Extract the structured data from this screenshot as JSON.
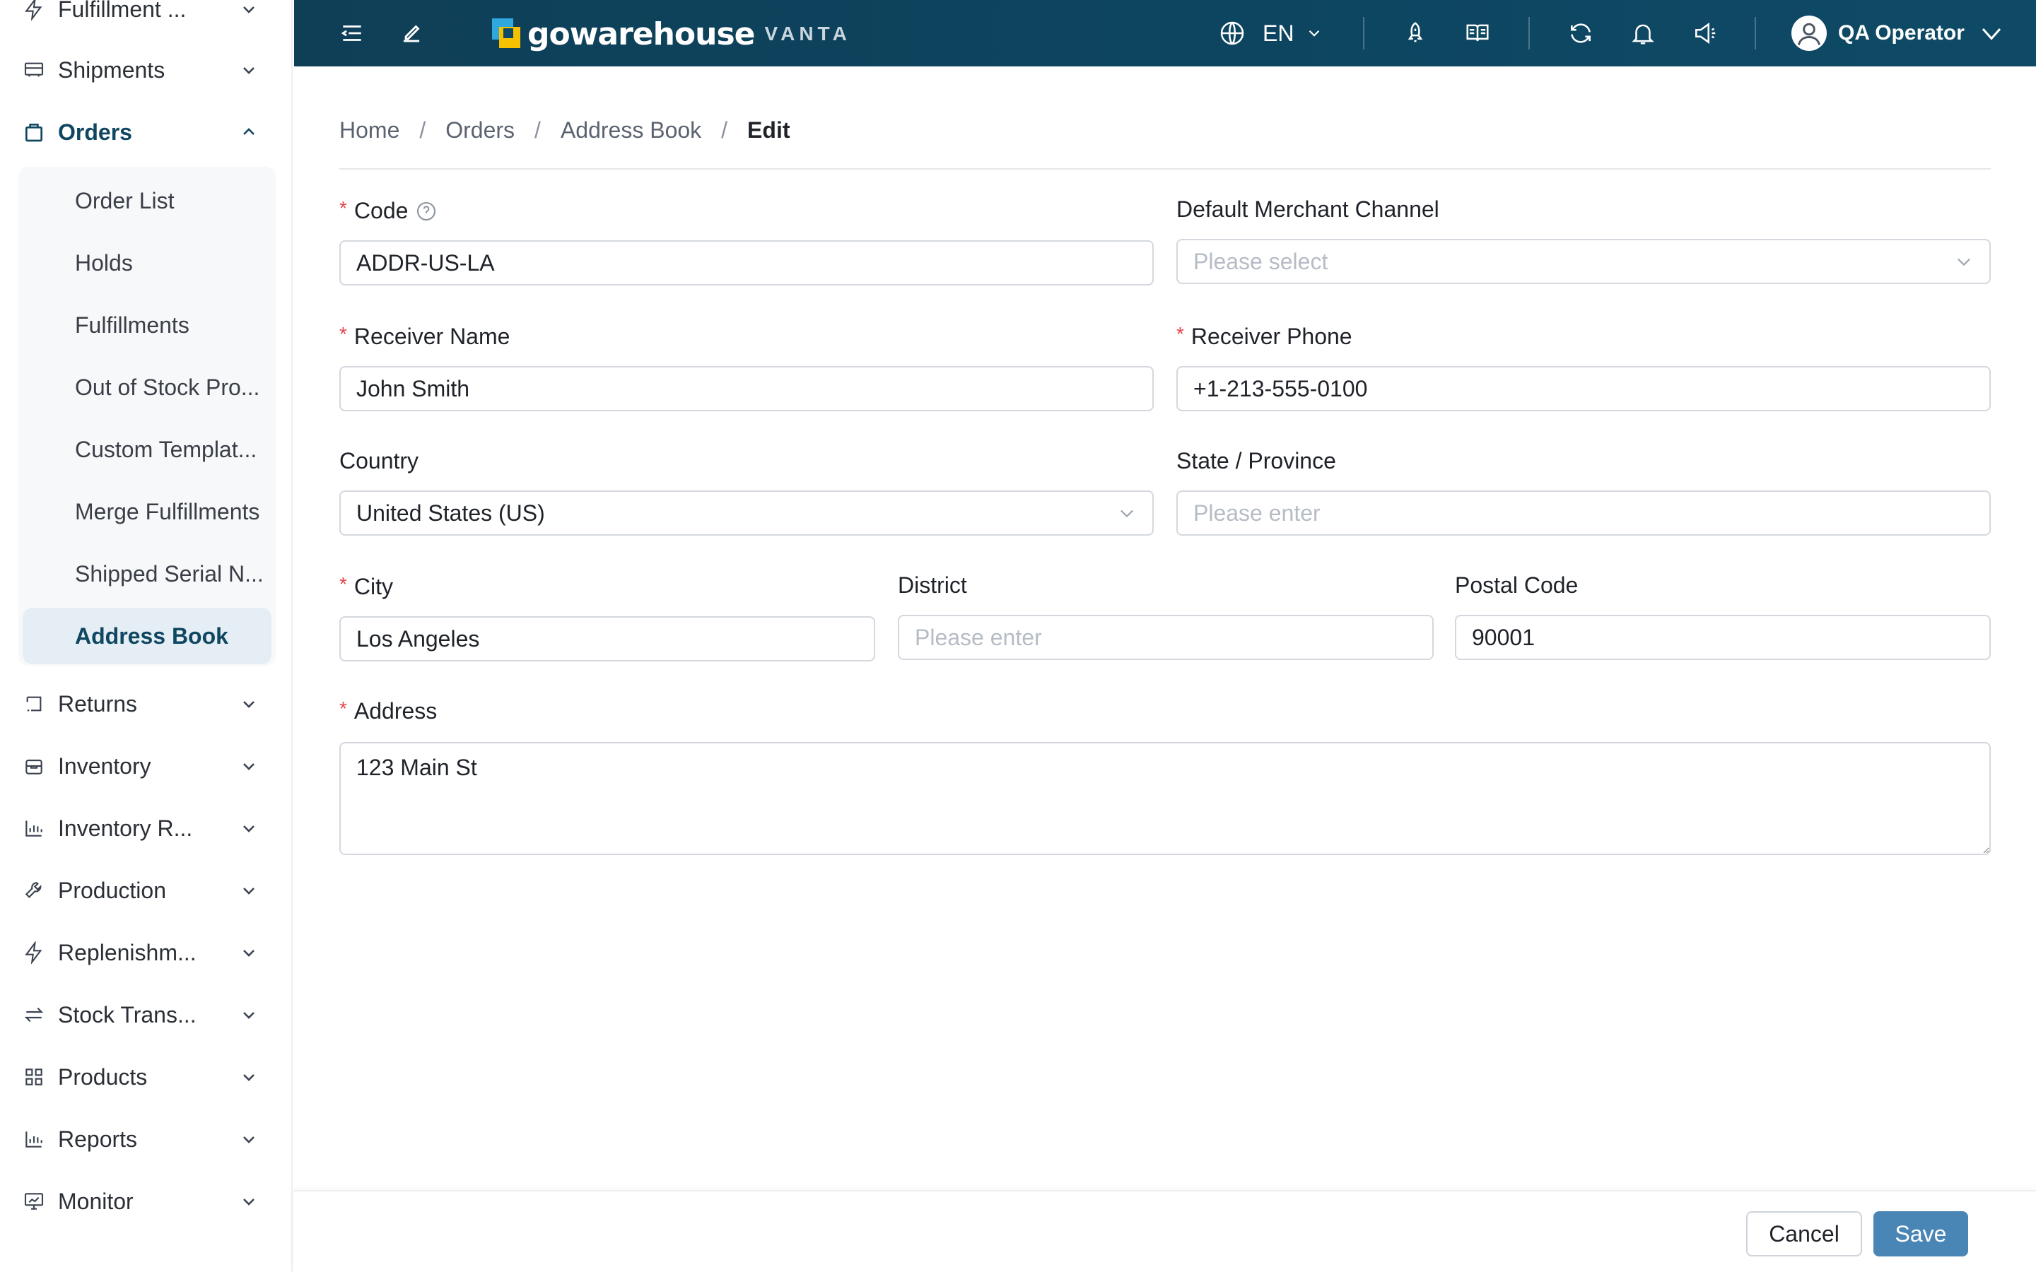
{
  "app": {
    "logo_text": "gowarehouse",
    "logo_sub": "VANTA",
    "language": "EN",
    "user_name": "QA Operator"
  },
  "sidebar": {
    "top_items": [
      {
        "label": "Fulfillment ...",
        "icon": "bolt-icon"
      },
      {
        "label": "Shipments",
        "icon": "truck-icon"
      },
      {
        "label": "Orders",
        "icon": "shopping-bag-icon"
      }
    ],
    "orders_submenu": [
      {
        "label": "Order List"
      },
      {
        "label": "Holds"
      },
      {
        "label": "Fulfillments"
      },
      {
        "label": "Out of Stock Pro..."
      },
      {
        "label": "Custom Templat..."
      },
      {
        "label": "Merge Fulfillments"
      },
      {
        "label": "Shipped Serial N..."
      },
      {
        "label": "Address Book"
      }
    ],
    "bottom_items": [
      {
        "label": "Returns",
        "icon": "return-icon"
      },
      {
        "label": "Inventory",
        "icon": "box-icon"
      },
      {
        "label": "Inventory R...",
        "icon": "bar-chart-icon"
      },
      {
        "label": "Production",
        "icon": "wrench-icon"
      },
      {
        "label": "Replenishm...",
        "icon": "bolt-icon"
      },
      {
        "label": "Stock Trans...",
        "icon": "transfer-icon"
      },
      {
        "label": "Products",
        "icon": "grid-icon"
      },
      {
        "label": "Reports",
        "icon": "bar-chart-icon"
      },
      {
        "label": "Monitor",
        "icon": "monitor-icon"
      }
    ]
  },
  "breadcrumb": {
    "items": [
      "Home",
      "Orders",
      "Address Book"
    ],
    "current": "Edit",
    "separator": "/"
  },
  "form": {
    "code": {
      "label": "Code",
      "value": "ADDR-US-LA"
    },
    "merchant_channel": {
      "label": "Default Merchant Channel",
      "placeholder": "Please select"
    },
    "receiver_name": {
      "label": "Receiver Name",
      "value": "John Smith"
    },
    "receiver_phone": {
      "label": "Receiver Phone",
      "value": "+1-213-555-0100"
    },
    "country": {
      "label": "Country",
      "value": "United States (US)"
    },
    "state": {
      "label": "State / Province",
      "placeholder": "Please enter"
    },
    "city": {
      "label": "City",
      "value": "Los Angeles"
    },
    "district": {
      "label": "District",
      "placeholder": "Please enter"
    },
    "postal_code": {
      "label": "Postal Code",
      "value": "90001"
    },
    "address": {
      "label": "Address",
      "value": "123 Main St"
    },
    "required_mark": "*"
  },
  "footer": {
    "cancel_label": "Cancel",
    "save_label": "Save"
  },
  "colors": {
    "topbar": "#0e4a66",
    "accent": "#0f4761",
    "save_button": "#4a86b5",
    "required": "#e5484d"
  }
}
